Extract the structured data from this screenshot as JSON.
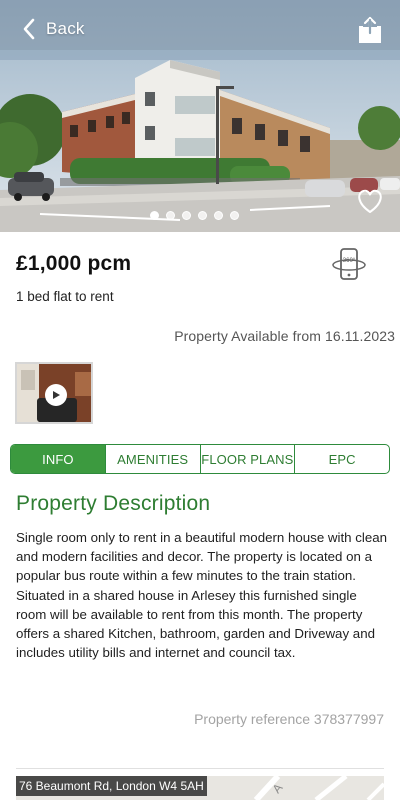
{
  "header": {
    "back_label": "Back"
  },
  "gallery": {
    "image_count": 6,
    "active_index": 0
  },
  "listing": {
    "price": "£1,000 pcm",
    "property_type": "1 bed flat to rent",
    "availability": "Property Available from 16.11.2023"
  },
  "tabs": [
    {
      "label": "INFO",
      "active": true
    },
    {
      "label": "AMENITIES",
      "active": false
    },
    {
      "label": "FLOOR PLANS",
      "active": false
    },
    {
      "label": "EPC",
      "active": false
    }
  ],
  "description": {
    "title": "Property Description",
    "body": "Single room only to rent in a beautiful modern house with clean and modern facilities and decor. The property is located on a popular bus route within a few minutes to the train station. Situated in a shared house in Arlesey this furnished single room will be available to rent from this month. The property offers a shared Kitchen, bathroom, garden and Driveway and includes utility bills and internet and council tax."
  },
  "reference": "Property reference 378377997",
  "map": {
    "address": "76 Beaumont Rd, London W4 5AH"
  },
  "icons": {
    "back": "chevron-left-icon",
    "share": "share-icon",
    "favourite": "heart-icon",
    "virtual_tour": "phone-360-icon",
    "play": "play-icon"
  },
  "colors": {
    "accent_green": "#2e7d32",
    "active_tab_bg": "#3c9a3f",
    "muted_text": "#a3a3a3"
  }
}
